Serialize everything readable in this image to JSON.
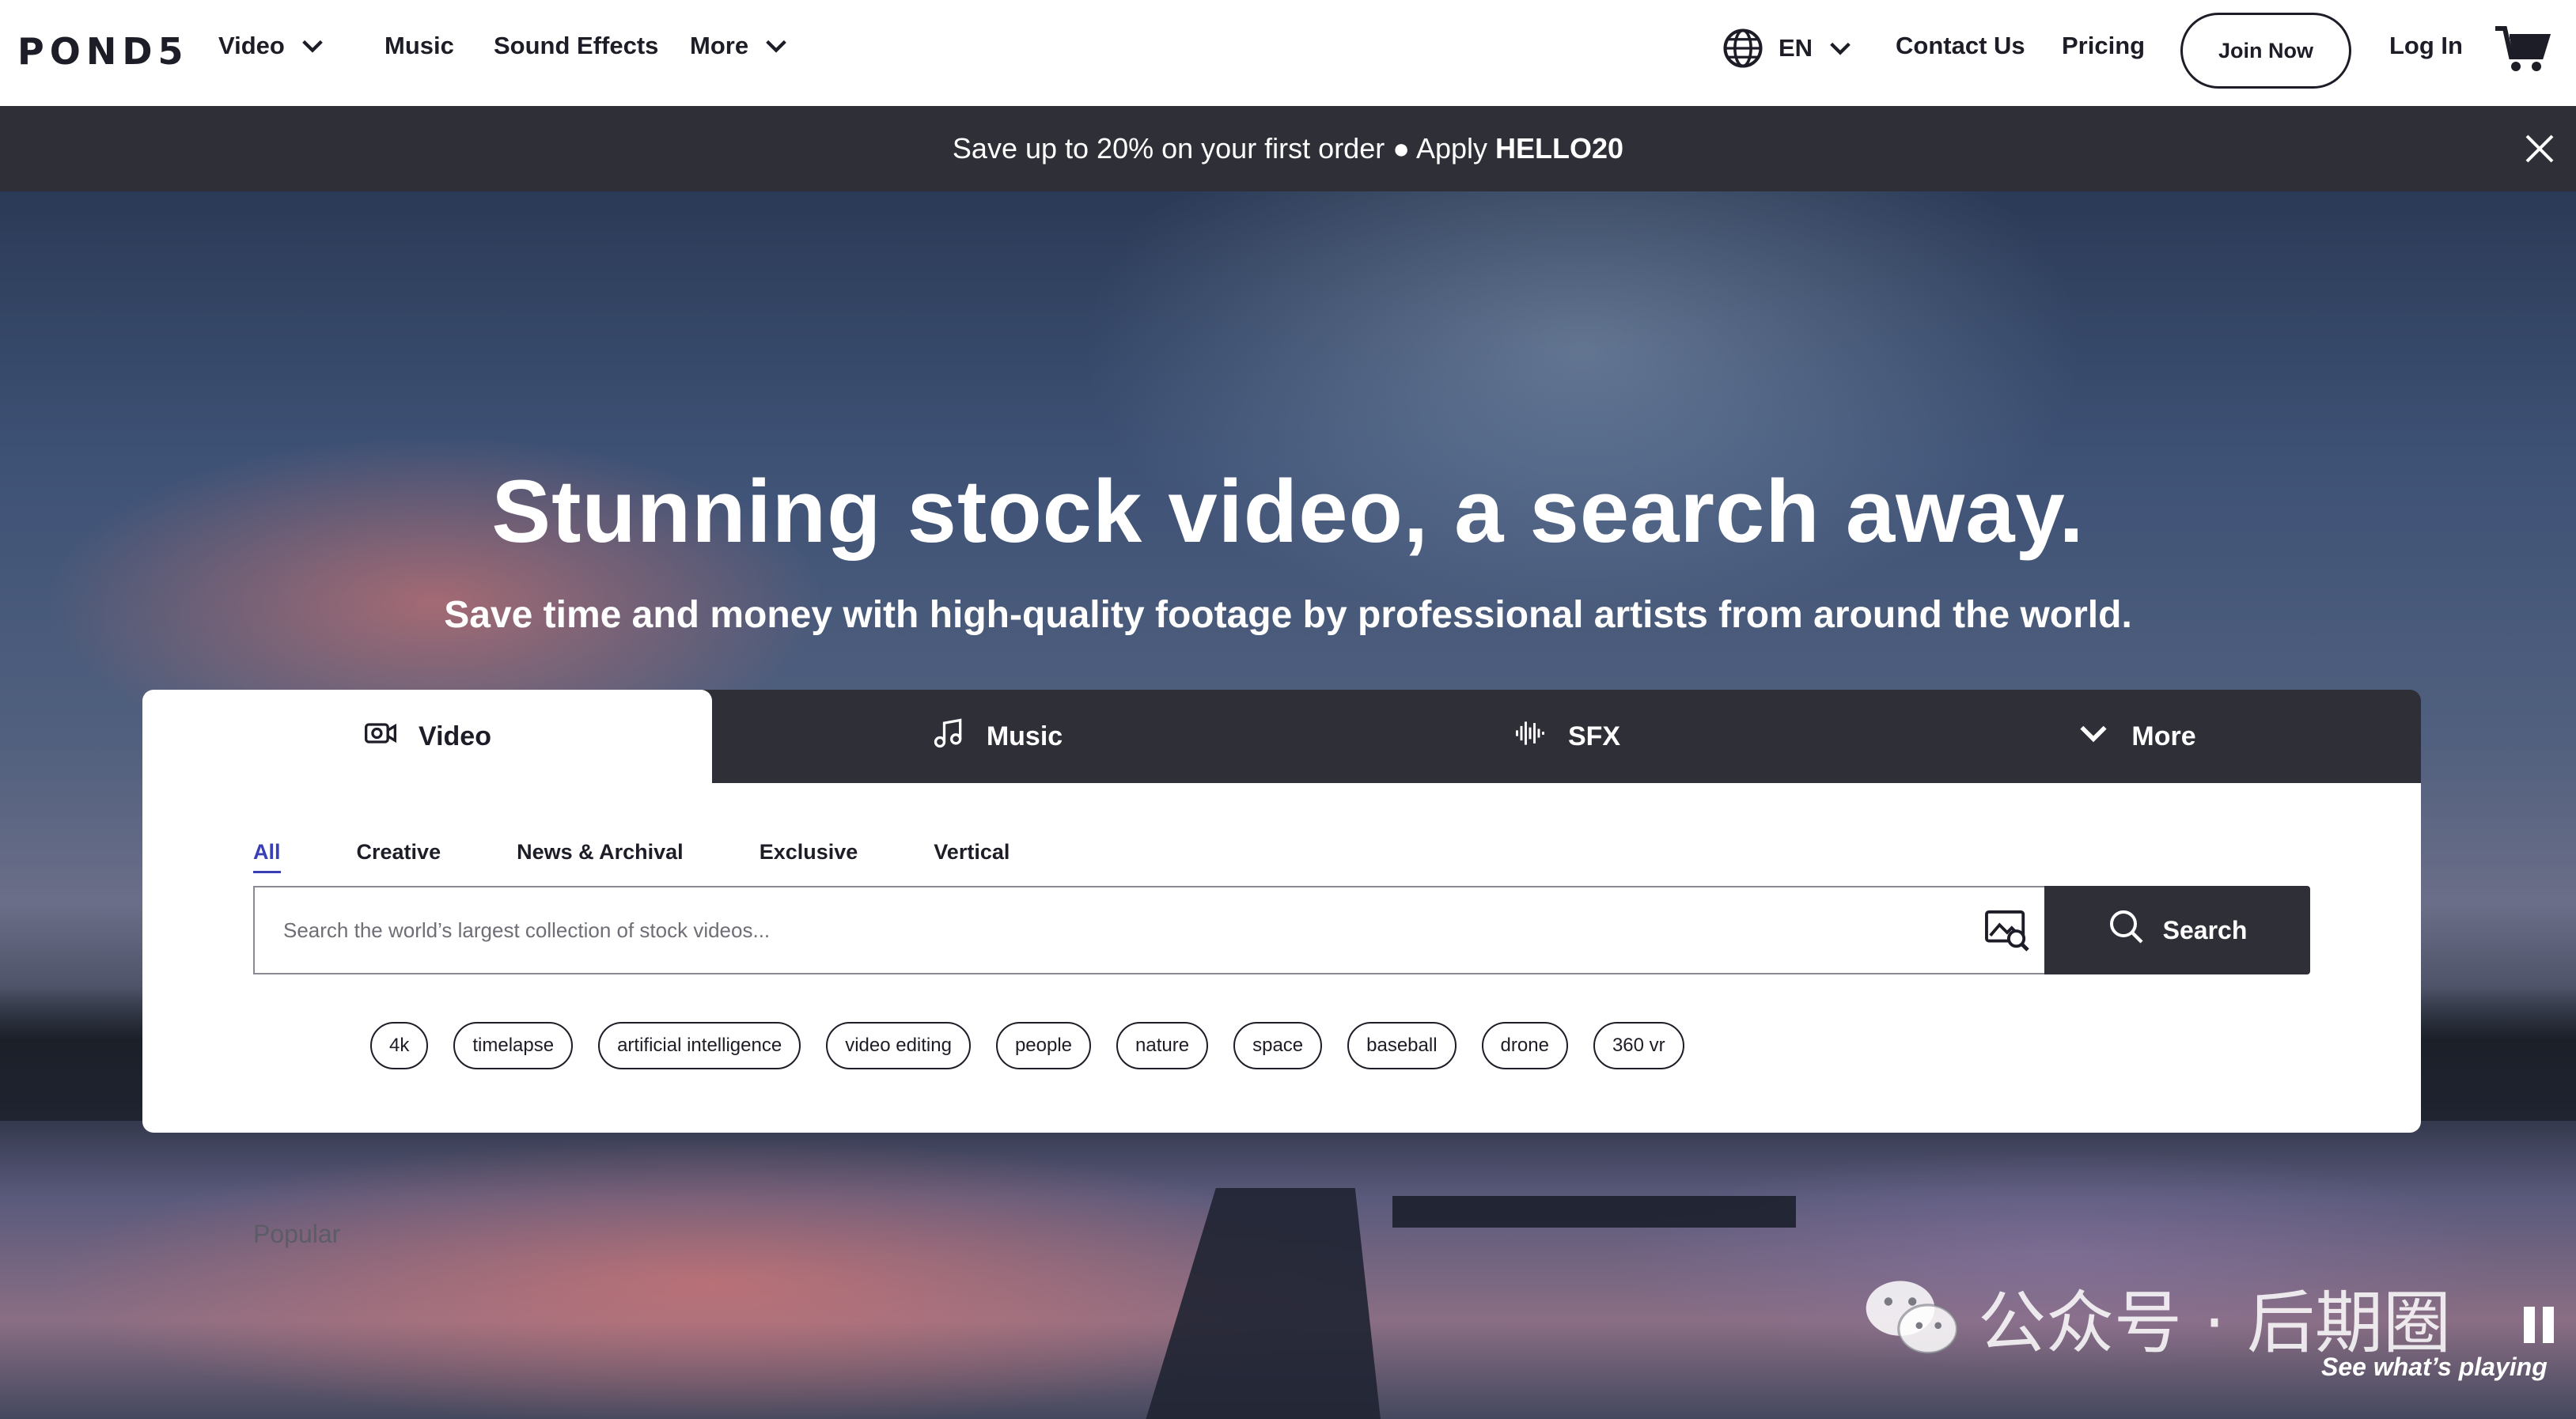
{
  "brand": {
    "logo": "POND5"
  },
  "nav": {
    "video": "Video",
    "music": "Music",
    "sound_effects": "Sound Effects",
    "more": "More",
    "language": "EN",
    "contact": "Contact Us",
    "pricing": "Pricing",
    "join": "Join Now",
    "login": "Log In"
  },
  "promo": {
    "text": "Save up to 20% on your first order ● Apply",
    "code": "HELLO20"
  },
  "hero": {
    "title": "Stunning stock video, a search away.",
    "subtitle": "Save time and money with high-quality footage by professional artists from around the world."
  },
  "media_tabs": [
    {
      "label": "Video",
      "icon": "video-camera-icon"
    },
    {
      "label": "Music",
      "icon": "music-note-icon"
    },
    {
      "label": "SFX",
      "icon": "sound-wave-icon"
    },
    {
      "label": "More",
      "icon": "chevron-down-icon"
    }
  ],
  "sub_tabs": [
    "All",
    "Creative",
    "News & Archival",
    "Exclusive",
    "Vertical"
  ],
  "search": {
    "placeholder": "Search the world’s largest collection of stock videos...",
    "button": "Search"
  },
  "popular": {
    "label": "Popular",
    "tags": [
      "4k",
      "timelapse",
      "artificial intelligence",
      "video editing",
      "people",
      "nature",
      "space",
      "baseball",
      "drone",
      "360 vr"
    ]
  },
  "watermark": {
    "text": "公众号 · 后期圈"
  },
  "player": {
    "status": "See what’s playing"
  },
  "colors": {
    "dark": "#2f2f38",
    "accent": "#3b3fb6",
    "text": "#1d1d27"
  }
}
